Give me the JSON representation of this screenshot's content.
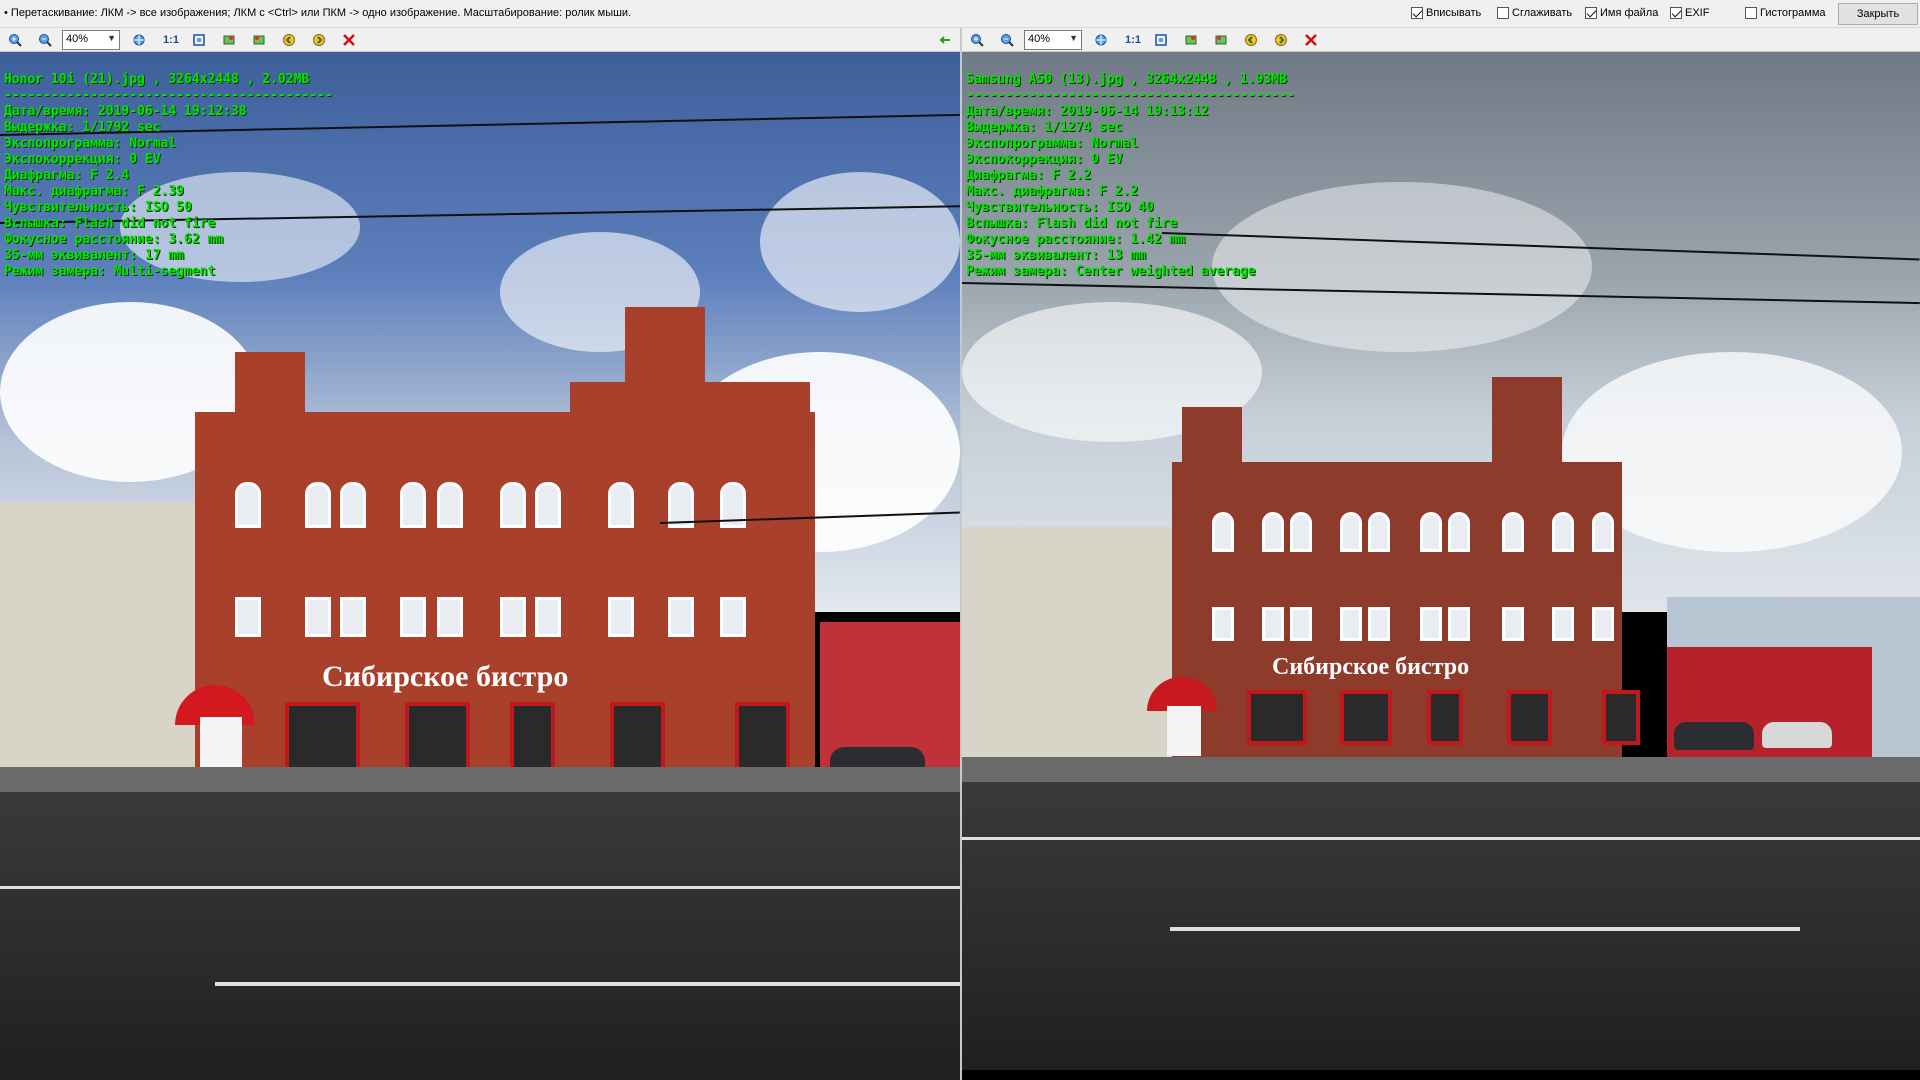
{
  "topbar": {
    "hint": "• Перетаскивание: ЛКМ -> все изображения; ЛКМ с <Ctrl> или ПКМ -> одно изображение. Масштабирование: ролик мыши.",
    "options": [
      {
        "label": "Вписывать",
        "checked": true
      },
      {
        "label": "Сглаживать",
        "checked": false
      },
      {
        "label": "Имя файла",
        "checked": true
      },
      {
        "label": "EXIF",
        "checked": true
      },
      {
        "label": "Гистограмма",
        "checked": false
      }
    ],
    "close_label": "Закрыть"
  },
  "left": {
    "zoom": "40%",
    "one_to_one": "1:1",
    "header": "Honor 10i (21).jpg , 3264x2448 , 2.02MB",
    "exif": [
      "------------------------------------------",
      "Дата/время: 2019-06-14 19:12:38",
      "Выдержка: 1/1792 sec",
      "Экспопрограмма: Normal",
      "Экспокоррекция: 0 EV",
      "Диафрагма: F 2.4",
      "Макс. диафрагма: F 2.39",
      "Чувствительность: ISO 50",
      "Вспышка: Flash did not fire",
      "Фокусное расстояние: 3.62 mm",
      "35-мм эквивалент: 17 mm",
      "Режим замера: Multi-segment"
    ],
    "sign": "Сибирское бистро"
  },
  "right": {
    "zoom": "40%",
    "one_to_one": "1:1",
    "header": "Samsung A50 (13).jpg , 3264x2448 , 1.93MB",
    "exif": [
      "------------------------------------------",
      "Дата/время: 2019-06-14 19:13:12",
      "Выдержка: 1/1274 sec",
      "Экспопрограмма: Normal",
      "Экспокоррекция: 0 EV",
      "Диафрагма: F 2.2",
      "Макс. диафрагма: F 2.2",
      "Чувствительность: ISO 40",
      "Вспышка: Flash did not fire",
      "Фокусное расстояние: 1.42 mm",
      "35-мм эквивалент: 13 mm",
      "Режим замера: Center weighted average"
    ],
    "sign": "Сибирское бистро"
  },
  "icons": {
    "zoom_in": "zoom-in-icon",
    "zoom_out": "zoom-out-icon",
    "fit": "fit-icon",
    "rotate_left": "rotate-left-icon",
    "rotate_right": "rotate-right-icon",
    "prev": "prev-image-icon",
    "next": "next-image-icon",
    "close": "close-icon",
    "sync": "sync-arrow-icon"
  },
  "colors": {
    "exif_text": "#00e400",
    "brick": "#a8402c",
    "close_x": "#d01010"
  }
}
